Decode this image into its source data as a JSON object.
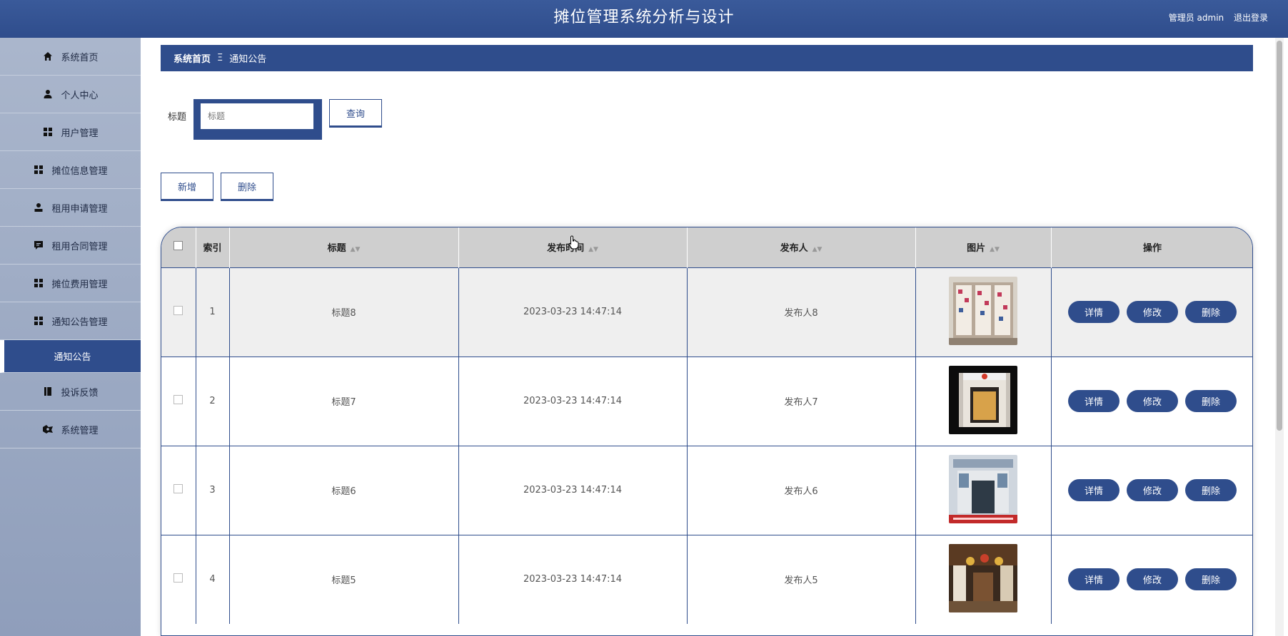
{
  "header": {
    "title": "摊位管理系统分析与设计",
    "user_label": "管理员 admin",
    "logout_label": "退出登录"
  },
  "sidebar": {
    "items": [
      {
        "label": "系统首页",
        "icon": "home-icon"
      },
      {
        "label": "个人中心",
        "icon": "user-icon"
      },
      {
        "label": "用户管理",
        "icon": "grid-icon"
      },
      {
        "label": "摊位信息管理",
        "icon": "grid-icon"
      },
      {
        "label": "租用申请管理",
        "icon": "person-icon"
      },
      {
        "label": "租用合同管理",
        "icon": "chat-icon"
      },
      {
        "label": "摊位费用管理",
        "icon": "grid-icon"
      },
      {
        "label": "通知公告管理",
        "icon": "grid-icon"
      },
      {
        "label": "通知公告",
        "icon": ""
      },
      {
        "label": "投诉反馈",
        "icon": "book-icon"
      },
      {
        "label": "系统管理",
        "icon": "settings-icon"
      }
    ]
  },
  "breadcrumb": {
    "home": "系统首页",
    "separator": "Ξ",
    "current": "通知公告"
  },
  "search": {
    "label": "标题",
    "placeholder": "标题",
    "button": "查询"
  },
  "actions": {
    "add": "新增",
    "delete": "删除"
  },
  "table": {
    "columns": {
      "index": "索引",
      "title": "标题",
      "time": "发布时间",
      "publisher": "发布人",
      "image": "图片",
      "ops": "操作"
    },
    "op_labels": {
      "detail": "详情",
      "edit": "修改",
      "delete": "删除"
    },
    "rows": [
      {
        "index": "1",
        "title": "标题8",
        "time": "2023-03-23 14:47:14",
        "publisher": "发布人8"
      },
      {
        "index": "2",
        "title": "标题7",
        "time": "2023-03-23 14:47:14",
        "publisher": "发布人7"
      },
      {
        "index": "3",
        "title": "标题6",
        "time": "2023-03-23 14:47:14",
        "publisher": "发布人6"
      },
      {
        "index": "4",
        "title": "标题5",
        "time": "2023-03-23 14:47:14",
        "publisher": "发布人5"
      }
    ]
  },
  "colors": {
    "primary": "#2f4d8c",
    "header_bg": "#cfcfcf"
  }
}
